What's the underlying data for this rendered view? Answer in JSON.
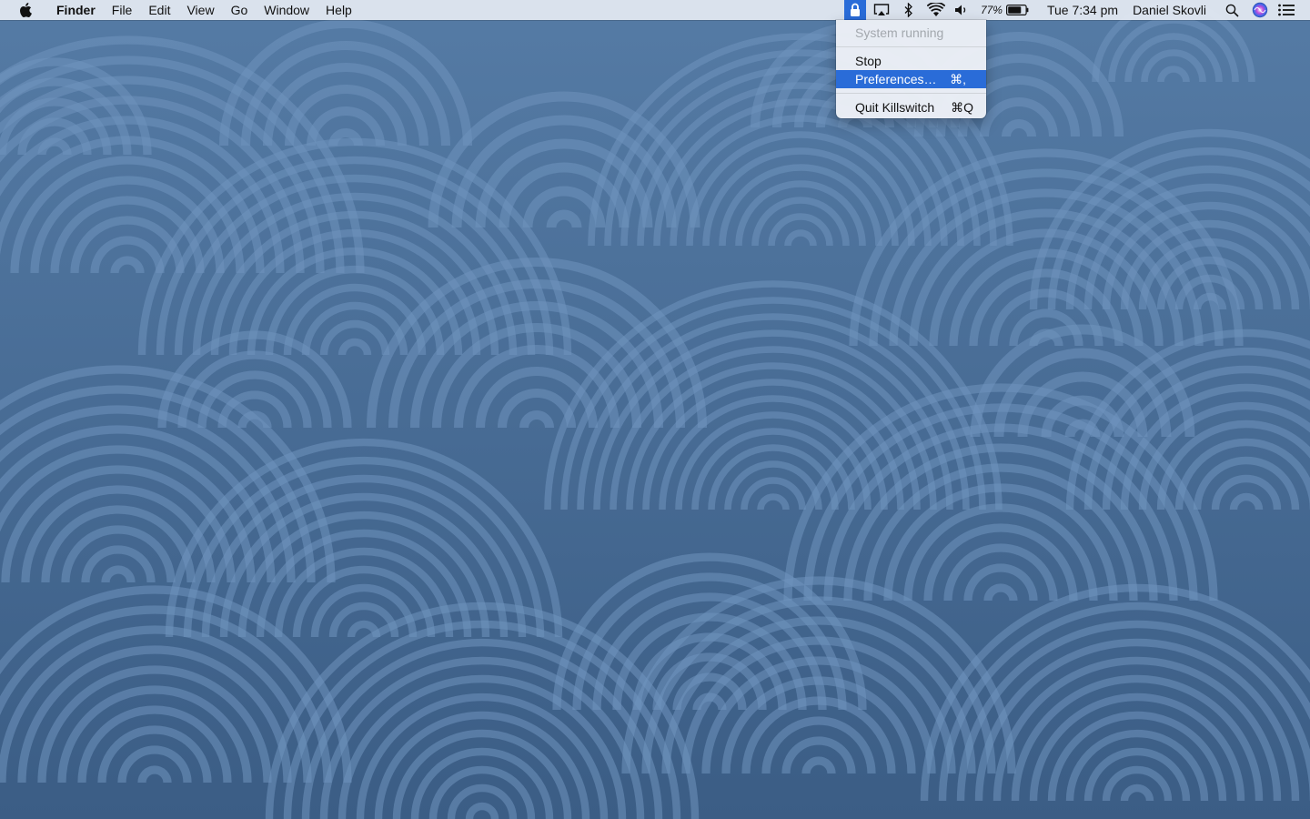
{
  "menubar": {
    "apple_icon": "apple-logo-icon",
    "app_name": "Finder",
    "menus": [
      "File",
      "Edit",
      "View",
      "Go",
      "Window",
      "Help"
    ],
    "status": {
      "killswitch_icon": "lock-icon",
      "airplay_icon": "airplay-icon",
      "bluetooth_icon": "bluetooth-icon",
      "wifi_icon": "wifi-icon",
      "volume_icon": "volume-icon",
      "battery_percent": "77%",
      "battery_level": 0.77,
      "clock": "Tue 7:34 pm",
      "user": "Daniel Skovli",
      "spotlight_icon": "search-icon",
      "siri_icon": "siri-icon",
      "notification_icon": "list-icon"
    }
  },
  "dropdown": {
    "status_text": "System running",
    "stop_label": "Stop",
    "preferences_label": "Preferences…",
    "preferences_shortcut": "⌘,",
    "quit_label": "Quit Killswitch",
    "quit_shortcut": "⌘Q"
  },
  "colors": {
    "desktop": "#4a6e98",
    "arc": "#6f93bd",
    "highlight": "#2a6cd8"
  }
}
